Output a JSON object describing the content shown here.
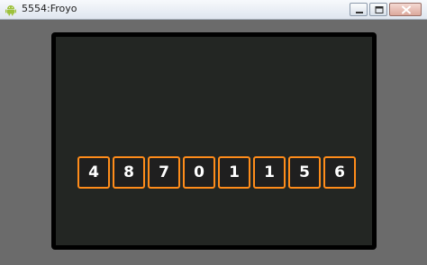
{
  "window": {
    "title": "5554:Froyo",
    "icon": "android-icon",
    "controls": {
      "minimize_icon": "minimize-icon",
      "maximize_icon": "maximize-icon",
      "close_icon": "close-icon"
    }
  },
  "screen": {
    "digits": [
      "4",
      "8",
      "7",
      "0",
      "1",
      "1",
      "5",
      "6"
    ],
    "accent_color": "#ff8c1a",
    "background_color": "#232623"
  }
}
